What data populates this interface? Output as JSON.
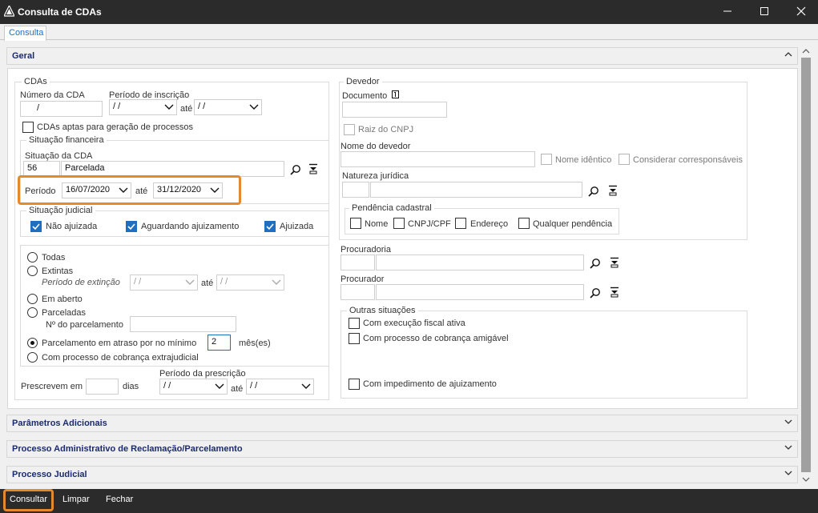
{
  "window": {
    "title": "Consulta de CDAs"
  },
  "tabs": [
    {
      "label": "Consulta"
    }
  ],
  "sections": {
    "geral": "Geral",
    "parametros": "Parâmetros Adicionais",
    "processo_adm": "Processo Administrativo de Reclamação/Parcelamento",
    "processo_judicial": "Processo Judicial"
  },
  "cdas": {
    "legend": "CDAs",
    "numero_label": "Número da CDA",
    "numero_value": "/",
    "periodo_inscricao_label": "Período de inscrição",
    "periodo_inscricao_de": " / /",
    "periodo_inscricao_ate_label": "até",
    "periodo_inscricao_ate": " / /",
    "aptas_label": "CDAs aptas para geração de processos"
  },
  "situacao_financeira": {
    "legend": "Situação financeira",
    "situacao_label": "Situação da CDA",
    "situacao_code": "56",
    "situacao_desc": "Parcelada",
    "periodo_label": "Período",
    "periodo_de": "16/07/2020",
    "periodo_ate_label": "até",
    "periodo_ate": "31/12/2020"
  },
  "situacao_judicial": {
    "legend": "Situação judicial",
    "nao_ajuizada": "Não ajuizada",
    "aguardando": "Aguardando ajuizamento",
    "ajuizada": "Ajuizada"
  },
  "opcoes": {
    "todas": "Todas",
    "extintas": "Extintas",
    "periodo_extincao_label": "Período de extinção",
    "periodo_extincao_de": " / /",
    "periodo_extincao_ate_label": "até",
    "periodo_extincao_ate": " / /",
    "em_aberto": "Em aberto",
    "parceladas": "Parceladas",
    "num_parcelamento_label": "Nº do parcelamento",
    "atraso_label": "Parcelamento em atraso por no mínimo",
    "atraso_value": "2",
    "atraso_unit": "mês(es)",
    "extrajudicial": "Com processo de cobrança extrajudicial"
  },
  "prescricao": {
    "prescrevem_label": "Prescrevem em",
    "dias_label": "dias",
    "periodo_label": "Período da prescrição",
    "periodo_de": " / /",
    "ate_label": "até",
    "periodo_ate": " / /"
  },
  "devedor": {
    "legend": "Devedor",
    "documento_label": "Documento",
    "raiz_cnpj": "Raiz do CNPJ",
    "nome_label": "Nome do devedor",
    "nome_identico": "Nome idêntico",
    "corresponsaveis": "Considerar corresponsáveis",
    "natureza_label": "Natureza jurídica",
    "pendencia_legend": "Pendência cadastral",
    "pend_nome": "Nome",
    "pend_cnpj": "CNPJ/CPF",
    "pend_endereco": "Endereço",
    "pend_qualquer": "Qualquer pendência"
  },
  "procuradoria": {
    "label": "Procuradoria"
  },
  "procurador": {
    "label": "Procurador"
  },
  "outras": {
    "legend": "Outras situações",
    "execucao": "Com execução fiscal ativa",
    "amigavel": "Com processo de cobrança amigável",
    "impedimento": "Com impedimento de ajuizamento"
  },
  "actions": {
    "consultar": "Consultar",
    "limpar": "Limpar",
    "fechar": "Fechar"
  },
  "colors": {
    "accent": "#1e6fc2",
    "highlight": "#e38a2e",
    "titlebar": "#2b2b2b"
  }
}
